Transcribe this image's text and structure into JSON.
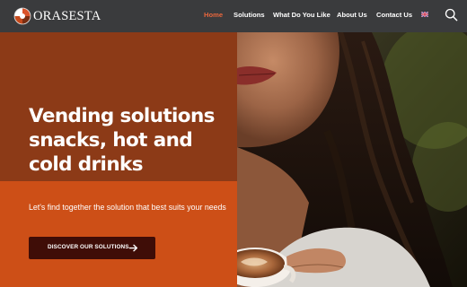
{
  "brand": {
    "name": "ORASESTA"
  },
  "nav": {
    "items": [
      {
        "label": "Home",
        "active": true
      },
      {
        "label": "Solutions",
        "active": false
      },
      {
        "label": "What Do You Like",
        "active": false
      },
      {
        "label": "About Us",
        "active": false
      },
      {
        "label": "Contact Us",
        "active": false
      }
    ],
    "language_icon": "uk-flag-icon",
    "search_icon": "search-icon"
  },
  "hero": {
    "headline": "Vending solutions snacks, hot and cold drinks",
    "subtext": "Let's find together the solution that best suits your needs",
    "cta_label": "DISCOVER OUR SOLUTIONS",
    "cta_icon": "arrow-right-icon",
    "image": "woman-with-coffee-cup-photo"
  },
  "colors": {
    "header_bg": "#3a3b3d",
    "nav_active": "#e8663d",
    "hero_upper_bg": "#8c3a17",
    "hero_lower_bg": "#cd4f17",
    "cta_bg": "#3f0d07"
  }
}
